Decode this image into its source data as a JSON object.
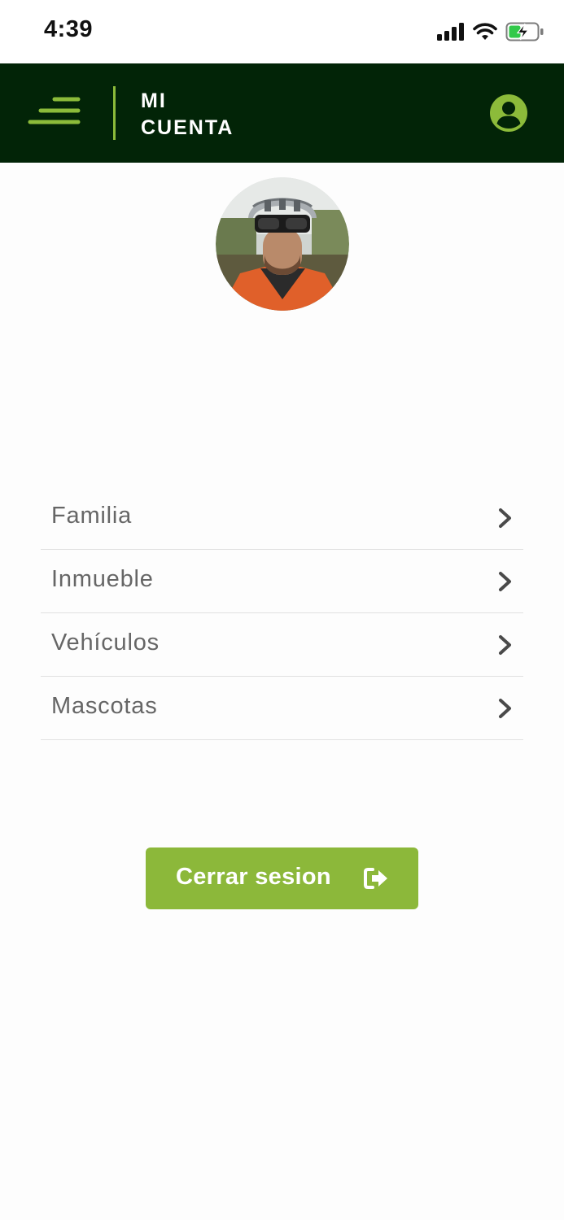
{
  "status_bar": {
    "time": "4:39",
    "icons": [
      "signal-icon",
      "wifi-icon",
      "battery-charging-icon"
    ]
  },
  "header": {
    "title_line1": "MI",
    "title_line2": "CUENTA",
    "menu_icon": "menu-icon",
    "profile_icon": "user-circle-icon",
    "background_color": "#022407",
    "accent_color": "#8cbb3a"
  },
  "profile": {
    "avatar_icon": "avatar-photo"
  },
  "menu": {
    "items": [
      {
        "label": "Familia"
      },
      {
        "label": "Inmueble"
      },
      {
        "label": "Vehículos"
      },
      {
        "label": "Mascotas"
      }
    ],
    "item_icon": "chevron-right-icon"
  },
  "logout": {
    "label": "Cerrar sesion",
    "icon": "sign-out-icon",
    "color": "#8cb83a"
  }
}
